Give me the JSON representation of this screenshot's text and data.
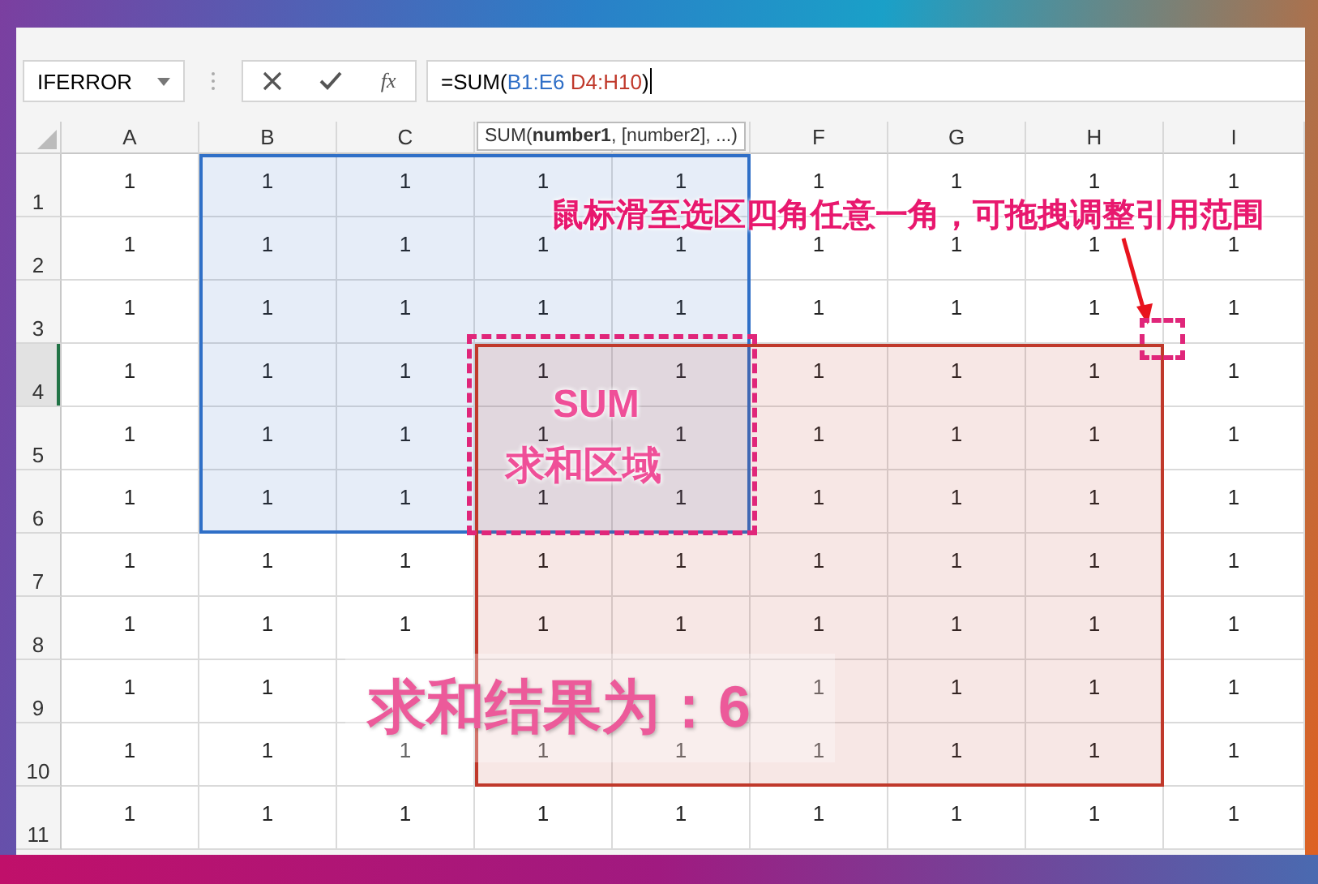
{
  "name_box": {
    "value": "IFERROR"
  },
  "formula_bar": {
    "function_label": "fx",
    "parts": [
      {
        "kind": "plain",
        "text": "=SUM("
      },
      {
        "kind": "ref",
        "text": "B1:E6",
        "color": "#2f6fc7"
      },
      {
        "kind": "ref",
        "text": " D4:H10",
        "color": "#c0392b"
      },
      {
        "kind": "plain",
        "text": ")"
      }
    ]
  },
  "tooltip": "SUM(**number1**, [number2], ...)",
  "columns": [
    {
      "kind": "label",
      "label": "A"
    },
    {
      "kind": "label",
      "label": "B"
    },
    {
      "kind": "label",
      "label": "C"
    },
    {
      "kind": "covered"
    },
    {
      "kind": "covered"
    },
    {
      "kind": "label",
      "label": "F"
    },
    {
      "kind": "label",
      "label": "G"
    },
    {
      "kind": "label",
      "label": "H"
    },
    {
      "kind": "label",
      "label": "I"
    }
  ],
  "rows": [
    {
      "label": "1",
      "selected": false,
      "cells": [
        "1",
        "1",
        "1",
        "1",
        "1",
        "1",
        "1",
        "1",
        "1"
      ]
    },
    {
      "label": "2",
      "selected": false,
      "cells": [
        "1",
        "1",
        "1",
        "1",
        "1",
        "1",
        "1",
        "1",
        "1"
      ]
    },
    {
      "label": "3",
      "selected": false,
      "cells": [
        "1",
        "1",
        "1",
        "1",
        "1",
        "1",
        "1",
        "1",
        "1"
      ]
    },
    {
      "label": "4",
      "selected": true,
      "cells": [
        "1",
        "1",
        "1",
        "1",
        "1",
        "1",
        "1",
        "1",
        "1"
      ]
    },
    {
      "label": "5",
      "selected": false,
      "cells": [
        "1",
        "1",
        "1",
        "1",
        "1",
        "1",
        "1",
        "1",
        "1"
      ]
    },
    {
      "label": "6",
      "selected": false,
      "cells": [
        "1",
        "1",
        "1",
        "1",
        "1",
        "1",
        "1",
        "1",
        "1"
      ]
    },
    {
      "label": "7",
      "selected": false,
      "cells": [
        "1",
        "1",
        "1",
        "1",
        "1",
        "1",
        "1",
        "1",
        "1"
      ]
    },
    {
      "label": "8",
      "selected": false,
      "cells": [
        "1",
        "1",
        "1",
        "1",
        "1",
        "1",
        "1",
        "1",
        "1"
      ]
    },
    {
      "label": "9",
      "selected": false,
      "cells": [
        "1",
        "1",
        {
          "kind": "covered"
        },
        {
          "kind": "covered"
        },
        {
          "kind": "covered"
        },
        "1",
        "1",
        "1",
        "1"
      ]
    },
    {
      "label": "10",
      "selected": false,
      "cells": [
        "1",
        "1",
        "1",
        "1",
        "1",
        "1",
        "1",
        "1",
        "1"
      ]
    },
    {
      "label": "11",
      "selected": false,
      "cells": [
        "1",
        "1",
        "1",
        "1",
        "1",
        "1",
        "1",
        "1",
        "1"
      ]
    }
  ],
  "annotations": {
    "hint": "鼠标滑至选区四角任意一角，可拖拽调整引用范围",
    "sum_label": [
      "SUM",
      "求和区域"
    ],
    "result": "求和结果为：6"
  }
}
